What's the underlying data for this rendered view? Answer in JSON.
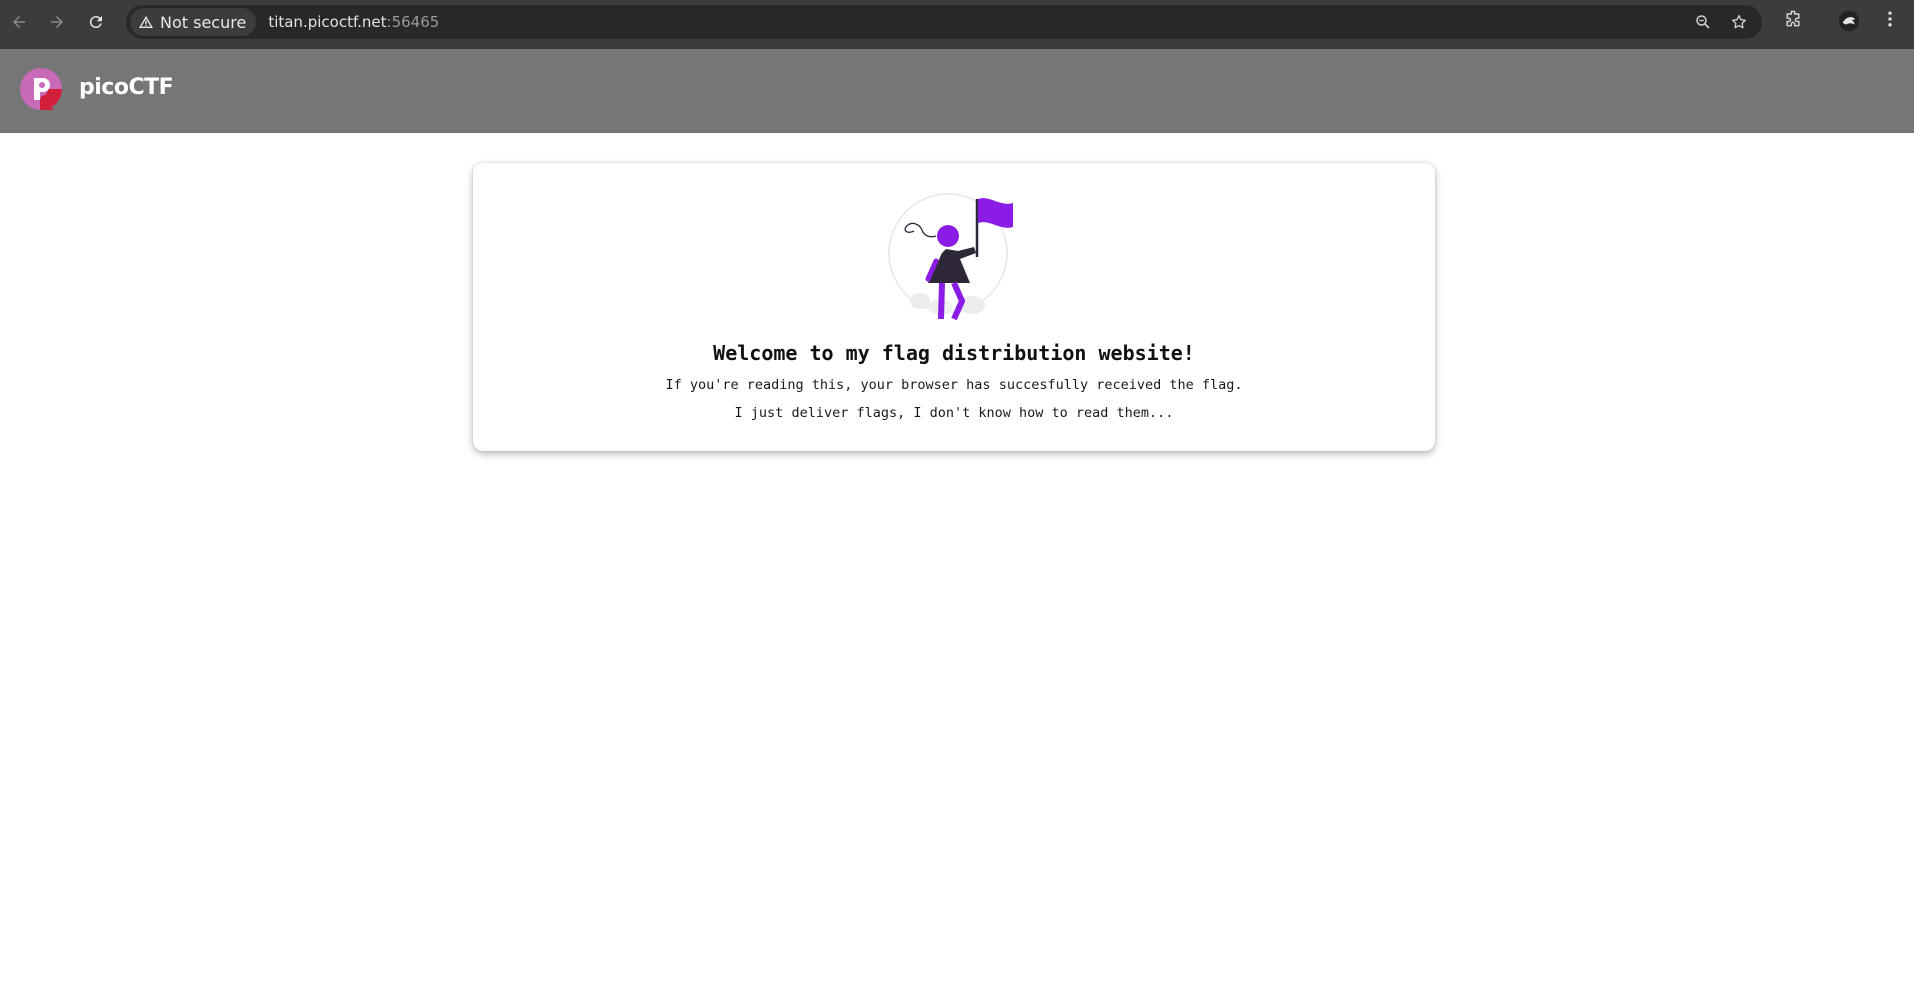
{
  "browser": {
    "security_chip": "Not secure",
    "url_host": "titan.picoctf.net",
    "url_port": ":56465",
    "icons": [
      "back-icon",
      "forward-icon",
      "reload-icon",
      "warning-icon",
      "zoom-icon",
      "bookmark-star-icon",
      "extensions-icon",
      "profile-avatar",
      "more-menu-icon"
    ]
  },
  "site": {
    "brand": "picoCTF",
    "colors": {
      "header_bg": "#767676",
      "accent": "#8a1ce6",
      "logo_pink": "#c86ab8",
      "logo_red": "#d21f3c"
    }
  },
  "card": {
    "title": "Welcome to my flag distribution website!",
    "line1": "If you're reading this, your browser has succesfully received the flag.",
    "line2": "I just deliver flags, I don't know how to read them..."
  }
}
